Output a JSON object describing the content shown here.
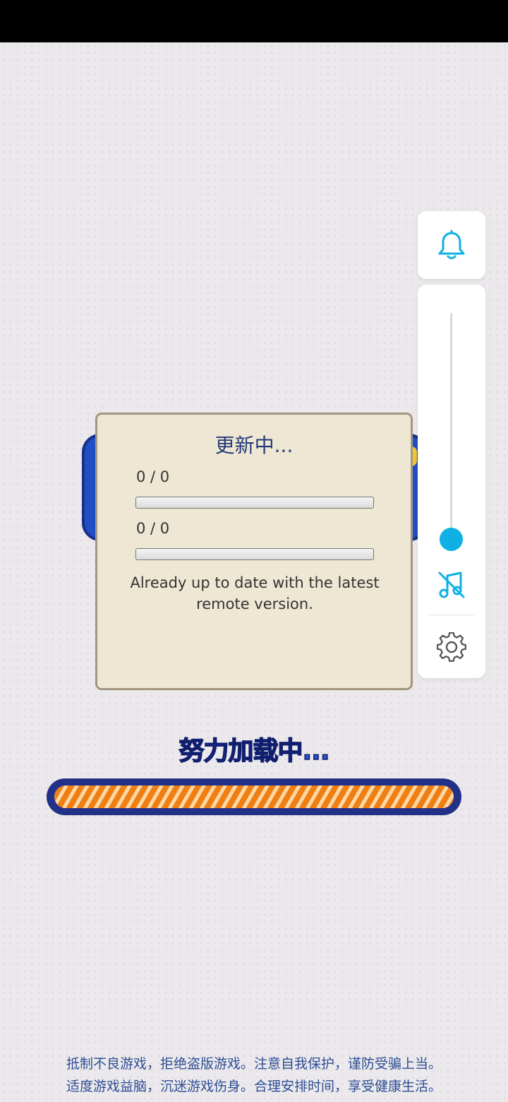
{
  "colors": {
    "background": "#ece9ec",
    "dialog_bg": "#eee7d3",
    "dialog_border": "#a39680",
    "title_text": "#253a7a",
    "accent": "#0fb1e4",
    "loading_orange": "#f07f13",
    "loading_frame": "#213088",
    "notice_text": "#2d4e94"
  },
  "dialog": {
    "title": "更新中...",
    "file_count_label": "0 / 0",
    "byte_count_label": "0 / 0",
    "file_progress": 0,
    "byte_progress": 0,
    "message": "Already up to date with the latest remote version."
  },
  "side_panel": {
    "bell_icon": "bell-icon",
    "volume_level": 0,
    "music_icon": "music-muted-icon",
    "settings_icon": "gear-icon"
  },
  "loading": {
    "text": "努力加载中...",
    "progress": 1.0
  },
  "notice": {
    "line1": "抵制不良游戏，拒绝盗版游戏。注意自我保护，谨防受骗上当。",
    "line2": "适度游戏益脑，沉迷游戏伤身。合理安排时间，享受健康生活。"
  }
}
